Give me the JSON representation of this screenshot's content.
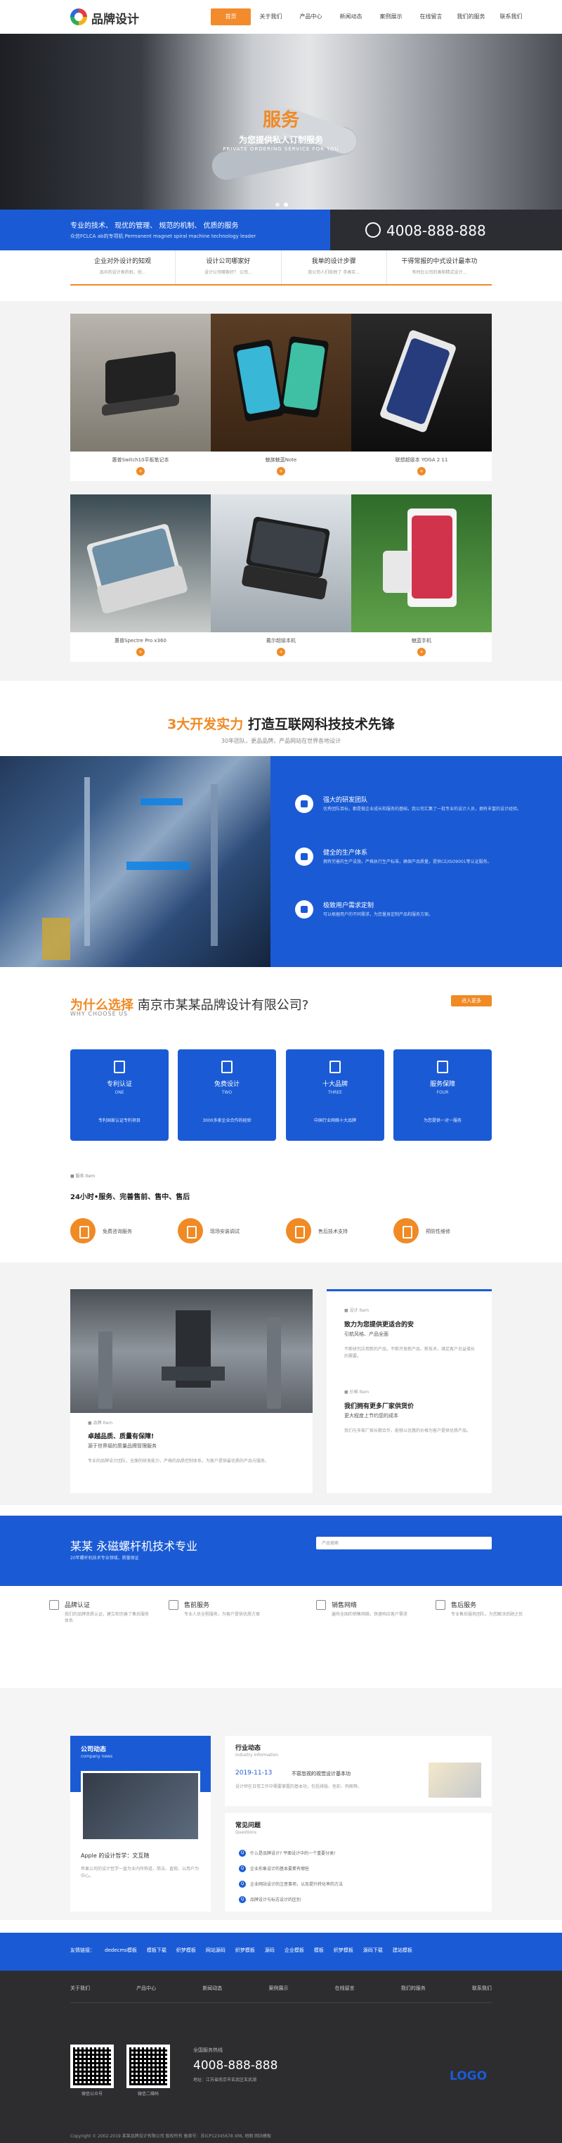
{
  "header": {
    "logo_text": "品牌设计",
    "nav": [
      "首页",
      "关于我们",
      "产品中心",
      "新闻动态",
      "案例展示",
      "在线留言",
      "我们的服务",
      "联系我们"
    ]
  },
  "banner": {
    "title": "服务",
    "subtitle": "为您提供私人订制服务",
    "subtitle_en": "PRIVATE ORDERING SERVICE FOR YOU"
  },
  "strip": {
    "slogan": "专业的技术、 现优的管理、 规范的机制、 优质的服务",
    "slogan_en": "众信FCLCA ab的专项机 Permanent magnet spiral machine technology leader",
    "phone": "4008-888-888"
  },
  "info_tabs": [
    {
      "title": "企业对外设计的知观",
      "desc": "品众的设计表的机、创..."
    },
    {
      "title": "设计公司哪家好",
      "desc": "设计公司哪家好？ 公司..."
    },
    {
      "title": "我单的设计步骤",
      "desc": "我公司人们给他了 手高实..."
    },
    {
      "title": "干得常报的中式设计最本功",
      "desc": "有时比公司的高和精式设计..."
    }
  ],
  "products": [
    "惠普Switch10平板笔记本",
    "魅族魅蓝Note",
    "联想超级本 YOGA 2 11",
    "惠普Spectre Pro x360",
    "戴尔超级本机",
    "魅蓝手机"
  ],
  "product_icon": "+",
  "strength": {
    "title_hl": "3大开发实力",
    "title": "打造互联网科技技术先锋",
    "subtitle": "30年团队，更品品牌，产品网站在世界各地设计",
    "items": [
      {
        "title": "强大的研发团队",
        "desc": "优秀团队目标，都是做企业成长和服务的基础，我公司汇集了一批专业的设计人员，拥有丰富的设计经验。"
      },
      {
        "title": "健全的生产体系",
        "desc": "拥有完善的生产设施，严格执行生产标准，确保产品质量，提供CE/ISO9001等认证服务。"
      },
      {
        "title": "极致用户需求定制",
        "desc": "可以根据用户的不同需求，为您量身定制产品和服务方案。"
      }
    ]
  },
  "why": {
    "title_hl": "为什么选择",
    "title": "南京市某某品牌设计有限公司?",
    "title_en": "WHY CHOOSE US",
    "more": "进入更多",
    "cards": [
      {
        "title": "专利认证",
        "en": "ONE",
        "desc": "专利国家认证专利项目"
      },
      {
        "title": "免费设计",
        "en": "TWO",
        "desc": "3000多家企业合作的经验"
      },
      {
        "title": "十大品牌",
        "en": "THREE",
        "desc": "中国行业网络十大品牌"
      },
      {
        "title": "服务保障",
        "en": "FOUR",
        "desc": "为您提供一对一服务"
      }
    ],
    "tag": "■ 服务 Item",
    "tagline": "24小时•服务、完善售前、售中、售后",
    "services": [
      "免费咨询服务",
      "现场安装调试",
      "售后技术支持",
      "预防性维修"
    ]
  },
  "case": {
    "left_tag": "■ 品牌 Item",
    "left_title": "卓越品质、质量有保障!",
    "left_sub": "源于世界级的质量品牌管理服务",
    "left_desc": "专业的品牌设计团队，全面的研发能力，严格的品质控制体系，为客户提供最优质的产品与服务。",
    "right_tag": "■ 设计 Item",
    "right_title": "致力为您提供更适合的安",
    "right_sub": "引航风格、产品全面",
    "right_desc": "不断研究应用新的产品，不断开发新产品、新技术，满足客户日益增长的需要。",
    "right_tag2": "■ 价格 Item",
    "right_title2": "我们拥有更多厂家供货价",
    "right_sub2": "更大程度上节约您的成本",
    "right_desc2": "我们与多家厂家长期合作，能够以优惠的价格为客户提供优质产品。"
  },
  "tech": {
    "title": "某某 永磁螺杆机技术专业",
    "subtitle": "20年螺杆机技术专业领域，质量保证",
    "search_placeholder": "产品搜索"
  },
  "svc_row": [
    {
      "title": "品牌认证",
      "desc": "我们的品牌资质认证，建立和完善了售后服务体系"
    },
    {
      "title": "售前服务",
      "desc": "专业人员全程服务，为客户提供优质方案"
    },
    {
      "title": "销售网络",
      "desc": "遍布全国的销售网络，快速响应客户需求"
    },
    {
      "title": "售后服务",
      "desc": "专业售后服务团队，为您解决后顾之忧"
    }
  ],
  "news": {
    "left_title": "公司动态",
    "left_en": "company news",
    "left_item": "Apple 的设计哲学：文互随",
    "left_desc": "苹果公司的设计哲学一直为业内所称道，简洁、直观、以用户为中心。",
    "right_title": "行业动态",
    "right_en": "industry information",
    "date": "2019-11-13",
    "headline": "不容忽视的视觉设计基本功",
    "summary": "设计师在日常工作中需要掌握的基本功，包括排版、色彩、构图等。",
    "faq_title": "常见问题",
    "faq_en": "Questions",
    "faq": [
      "什么是品牌设计? 平面设计中的一个重要分类!",
      "企业形象设计的基本要素有哪些",
      "企业网站设计的注意事项，以及提升转化率的方法",
      "品牌设计与标志设计的区别"
    ]
  },
  "links": {
    "label": "友情链接：",
    "items": [
      "dedecms模板",
      "模板下载",
      "织梦模板",
      "网站源码",
      "织梦模板",
      "源码",
      "企业模板",
      "模板",
      "织梦模板",
      "源码下载",
      "建站模板"
    ]
  },
  "footer": {
    "nav": [
      "关于我们",
      "产品中心",
      "新闻动态",
      "案例展示",
      "在线留言",
      "我们的服务",
      "联系我们"
    ],
    "qr1_label": "微信公众号",
    "qr2_label": "微信二维码",
    "phone_label": "全国服务热线",
    "phone": "4008-888-888",
    "address": "地址：江苏省南京市玄武区玄武湖",
    "logo": "LOGO",
    "copyright": "Copyright © 2002-2019 某某品牌设计有限公司 版权所有 备案号：苏ICP12345678 XML 地图 网站模板"
  },
  "colors": {
    "accent": "#f08a24",
    "primary": "#1a5bd5"
  }
}
